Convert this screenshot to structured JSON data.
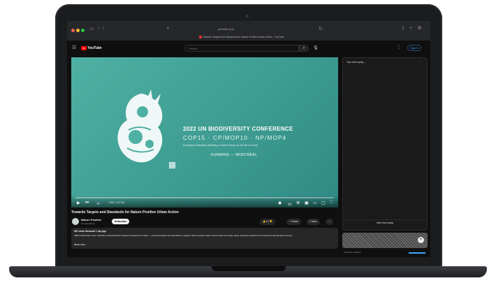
{
  "browser": {
    "url": "youtube.com",
    "tab_title": "Towards Targets and Standards for Nature Positive Urban Action - YouTube"
  },
  "header": {
    "logo_text": "YouTube",
    "search_placeholder": "Search",
    "sign_in_label": "Sign in"
  },
  "player": {
    "slide_title": "2022 UN BIODIVERSITY CONFERENCE",
    "slide_cop": "COP15 · CP/MOP10 · NP/MOP4",
    "slide_subtitle": "Ecological Civilization-Building a Shared Future for All Life on Earth",
    "slide_place": "KUNMING — MONTRÉAL",
    "time": "0:02 / 1:27:10",
    "progress_fraction": 0.0
  },
  "video": {
    "title": "Towards Targets and Standards for Nature Positive Urban Action",
    "channel_name": "Nature Positive",
    "channel_subs": "33 subscribers",
    "subscribe_label": "Subscribe",
    "like_count": "6",
    "share_label": "Share",
    "save_label": "Save",
    "more_label": "···",
    "description_meta": "522 views  Streamed 1 day ago",
    "description_body": "CBD COP15 side event: Towards a Global Nature Positive Framework for Cities — exploring targets and standards to support nature-positive action across cities and urban areas, featuring speakers from local and regional governments.",
    "description_more": "Show more"
  },
  "sidebar": {
    "chat_header": "Top chat replay ⌄",
    "chat_button": "Hide chat replay",
    "recommendation_label": "All   Nature Positive",
    "accent": "#3ea6ff"
  },
  "icons": {
    "menu": "menu-icon",
    "search": "search-icon",
    "mic": "mic-icon",
    "play": "play-icon",
    "next": "next-icon",
    "volume": "volume-icon",
    "settings": "gear-icon",
    "fullscreen": "fullscreen-icon"
  }
}
